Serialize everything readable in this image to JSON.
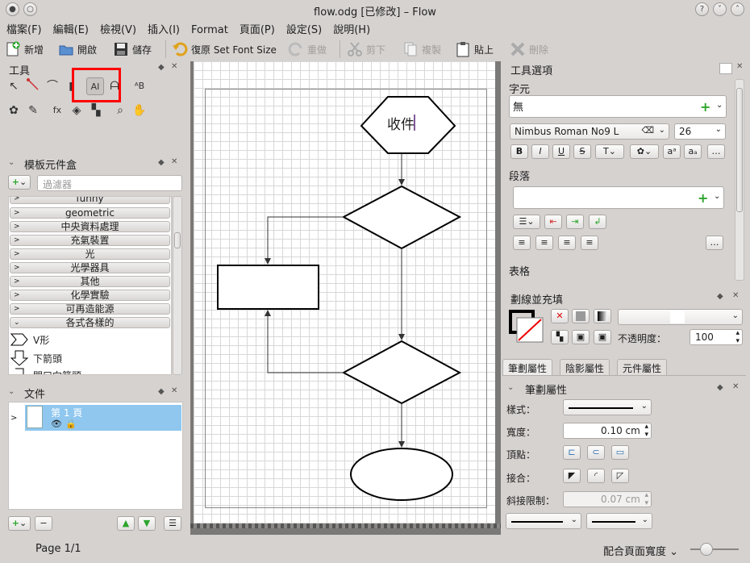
{
  "window": {
    "title": "flow.odg [已修改] – Flow"
  },
  "menu": [
    "檔案(F)",
    "編輯(E)",
    "檢視(V)",
    "插入(I)",
    "Format",
    "頁面(P)",
    "設定(S)",
    "說明(H)"
  ],
  "toolbar": {
    "new": "新增",
    "open": "開啟",
    "save": "儲存",
    "undo": "復原 Set Font Size",
    "redo": "重做",
    "cut": "剪下",
    "copy": "複製",
    "paste": "貼上",
    "delete": "刪除"
  },
  "tools_panel": {
    "title": "工具"
  },
  "stencil_panel": {
    "title": "模板元件盒",
    "filter_placeholder": "過濾器",
    "categories": [
      "funny",
      "geometric",
      "中央資料處理",
      "充氣裝置",
      "光",
      "光學器具",
      "其他",
      "化學實驗",
      "可再造能源",
      "各式各樣的"
    ],
    "shapes": [
      "V形",
      "下箭頭",
      "開口向箭頭"
    ]
  },
  "document_panel": {
    "title": "文件",
    "page_label": "第 1 頁"
  },
  "canvas": {
    "hexagon_text": "收件"
  },
  "tool_options": {
    "title": "工具選項",
    "char_section": "字元",
    "char_style": "無",
    "font": "Nimbus Roman No9 L",
    "size": "26",
    "para_section": "段落",
    "table_section": "表格"
  },
  "stroke_fill": {
    "title": "劃線並充填",
    "opacity_label": "不透明度：",
    "opacity": "100"
  },
  "tabs": [
    "筆劃屬性",
    "陰影屬性",
    "元件屬性"
  ],
  "stroke_props": {
    "title": "筆劃屬性",
    "style_label": "樣式：",
    "width_label": "寬度：",
    "width": "0.10 cm",
    "cap_label": "頂點：",
    "join_label": "接合：",
    "miter_label": "斜接限制：",
    "miter": "0.07 cm"
  },
  "status": {
    "page": "Page 1/1",
    "zoom": "配合頁面寬度"
  },
  "colors": {
    "highlight": "#ff0000",
    "selection": "#8fc7ef"
  }
}
